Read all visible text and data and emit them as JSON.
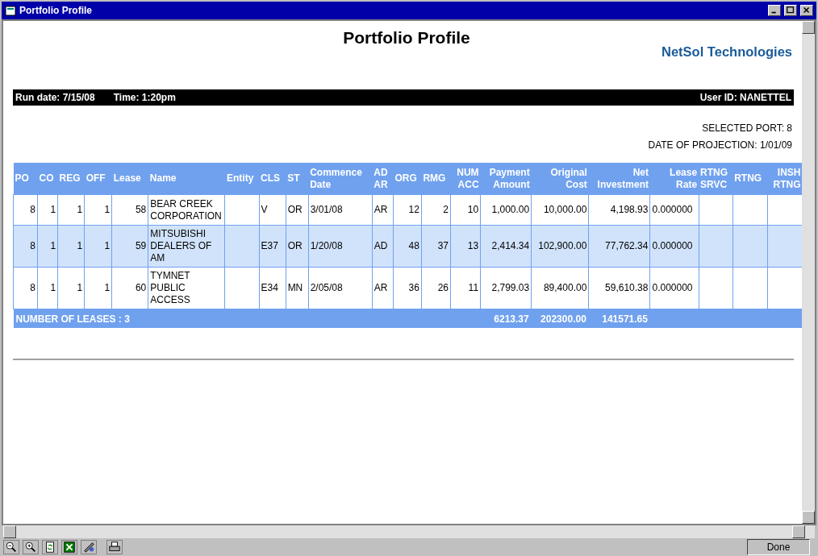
{
  "window": {
    "title": "Portfolio Profile"
  },
  "report": {
    "title": "Portfolio Profile",
    "company": "NetSol Technologies",
    "run_date": "Run date: 7/15/08",
    "time": "Time: 1:20pm",
    "user": "User ID: NANETTEL",
    "selected_port": "SELECTED PORT: 8",
    "projection_date": "DATE OF PROJECTION: 1/01/09"
  },
  "table": {
    "columns": [
      {
        "label": "PO"
      },
      {
        "label": "CO"
      },
      {
        "label": "REG"
      },
      {
        "label": "OFF"
      },
      {
        "label": "Lease"
      },
      {
        "label": "Name"
      },
      {
        "label": "Entity"
      },
      {
        "label": "CLS"
      },
      {
        "label": "ST"
      },
      {
        "label": "Commence Date"
      },
      {
        "label": "AD AR"
      },
      {
        "label": "ORG"
      },
      {
        "label": "RMG"
      },
      {
        "label": "NUM ACC"
      },
      {
        "label": "Payment Amount"
      },
      {
        "label": "Original Cost"
      },
      {
        "label": "Net Investment"
      },
      {
        "label": "Lease Rate"
      },
      {
        "label": "RTNG SRVC"
      },
      {
        "label": "RTNG"
      },
      {
        "label": "INSH RTNG"
      }
    ],
    "rows": [
      {
        "cells": [
          "8",
          "1",
          "1",
          "1",
          "58",
          "BEAR CREEK CORPORATION",
          "",
          "V",
          "OR",
          "3/01/08",
          "AR",
          "12",
          "2",
          "10",
          "1,000.00",
          "10,000.00",
          "4,198.93",
          "0.000000",
          "",
          "",
          ""
        ]
      },
      {
        "cells": [
          "8",
          "1",
          "1",
          "1",
          "59",
          "MITSUBISHI DEALERS OF AM",
          "",
          "E37",
          "OR",
          "1/20/08",
          "AD",
          "48",
          "37",
          "13",
          "2,414.34",
          "102,900.00",
          "77,762.34",
          "0.000000",
          "",
          "",
          ""
        ]
      },
      {
        "cells": [
          "8",
          "1",
          "1",
          "1",
          "60",
          "TYMNET PUBLIC ACCESS",
          "",
          "E34",
          "MN",
          "2/05/08",
          "AR",
          "36",
          "26",
          "11",
          "2,799.03",
          "89,400.00",
          "59,610.38",
          "0.000000",
          "",
          "",
          ""
        ]
      }
    ],
    "footer": {
      "label": "NUMBER OF LEASES : 3",
      "totals": [
        "6213.37",
        "202300.00",
        "141571.65"
      ]
    }
  },
  "status_bar": {
    "text": "Done"
  }
}
